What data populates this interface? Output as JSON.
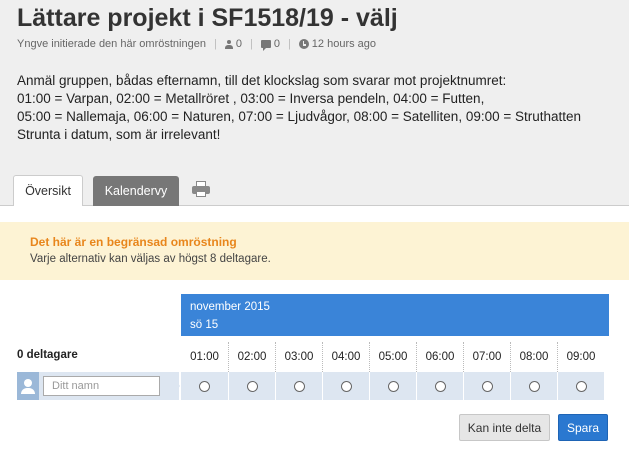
{
  "poll": {
    "title": "Lättare projekt i SF1518/19 - välj",
    "initiator": "Yngve initierade den här omröstningen",
    "participant_count": "0",
    "comment_count": "0",
    "time_ago": "12 hours ago",
    "description": [
      "Anmäl gruppen, bådas efternamn, till det klockslag som svarar mot projektnumret:",
      "01:00 = Varpan, 02:00 = Metallröret , 03:00 = Inversa pendeln, 04:00 = Futten,",
      "05:00 = Nallemaja, 06:00 = Naturen, 07:00 = Ljudvågor, 08:00 = Satelliten, 09:00 = Struthatten",
      "Strunta i datum, som är irrelevant!"
    ]
  },
  "tabs": {
    "overview": "Översikt",
    "calendar": "Kalendervy"
  },
  "notice": {
    "title": "Det här är en begränsad omröstning",
    "text": "Varje alternativ kan väljas av högst 8 deltagare."
  },
  "schedule": {
    "month": "november 2015",
    "day": "sö 15",
    "participants_label": "0 deltagare",
    "times": [
      "01:00",
      "02:00",
      "03:00",
      "04:00",
      "05:00",
      "06:00",
      "07:00",
      "08:00",
      "09:00"
    ]
  },
  "form": {
    "name_placeholder": "Ditt namn",
    "decline_label": "Kan inte delta",
    "save_label": "Spara"
  },
  "colors": {
    "accent": "#3a84d8",
    "notice_bg": "#fdf3d4",
    "notice_title": "#e8861c"
  }
}
